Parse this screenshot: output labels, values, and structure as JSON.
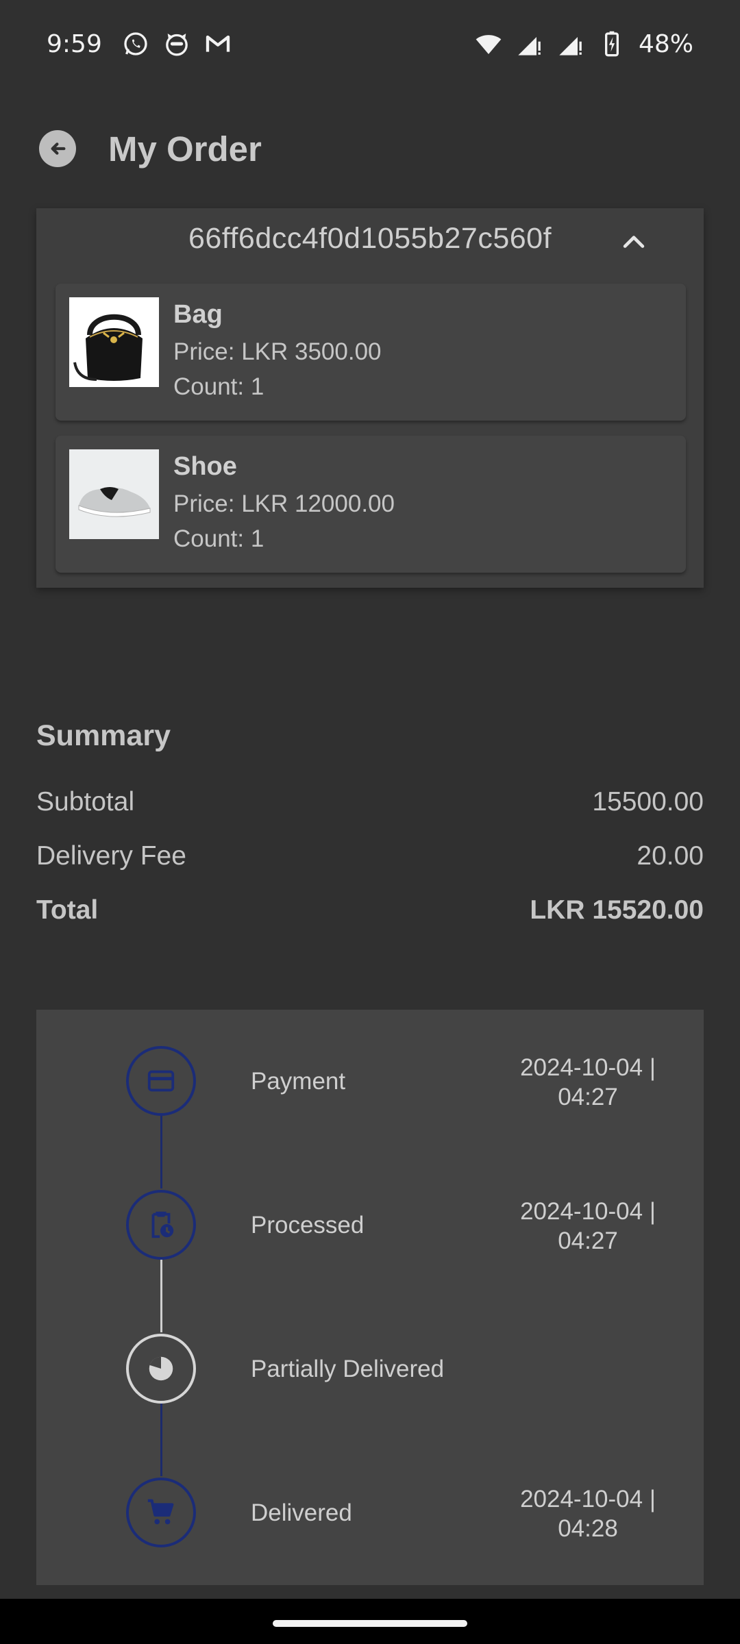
{
  "status_bar": {
    "time": "9:59",
    "battery_percent": "48%",
    "icons_left": [
      "whatsapp-icon",
      "cat-app-icon",
      "gmail-icon"
    ],
    "icons_right": [
      "wifi-icon",
      "signal-icon",
      "signal-icon",
      "battery-charging-icon"
    ]
  },
  "app_bar": {
    "title": "My Order",
    "back_icon": "arrow-back-icon"
  },
  "order": {
    "id": "66ff6dcc4f0d1055b27c560f",
    "expanded": true,
    "items": [
      {
        "name": "Bag",
        "price": "Price: LKR 3500.00",
        "count": "Count: 1",
        "image": "bag-image"
      },
      {
        "name": "Shoe",
        "price": "Price: LKR 12000.00",
        "count": "Count: 1",
        "image": "shoe-image"
      }
    ]
  },
  "summary": {
    "title": "Summary",
    "subtotal_label": "Subtotal",
    "subtotal_value": "15500.00",
    "delivery_label": "Delivery Fee",
    "delivery_value": "20.00",
    "total_label": "Total",
    "total_value": "LKR 15520.00"
  },
  "timeline": [
    {
      "label": "Payment",
      "date": "2024-10-04 |",
      "time": "04:27",
      "icon": "credit-card-icon",
      "active": true
    },
    {
      "label": "Processed",
      "date": "2024-10-04 |",
      "time": "04:27",
      "icon": "clipboard-clock-icon",
      "active": true
    },
    {
      "label": "Partially Delivered",
      "date": "",
      "time": "",
      "icon": "pie-chart-icon",
      "active": false
    },
    {
      "label": "Delivered",
      "date": "2024-10-04 |",
      "time": "04:28",
      "icon": "shopping-cart-icon",
      "active": true
    }
  ],
  "colors": {
    "background": "#303030",
    "card": "#3e3e3e",
    "timeline_active": "#1b2c78",
    "timeline_inactive": "#d6d6d6"
  }
}
